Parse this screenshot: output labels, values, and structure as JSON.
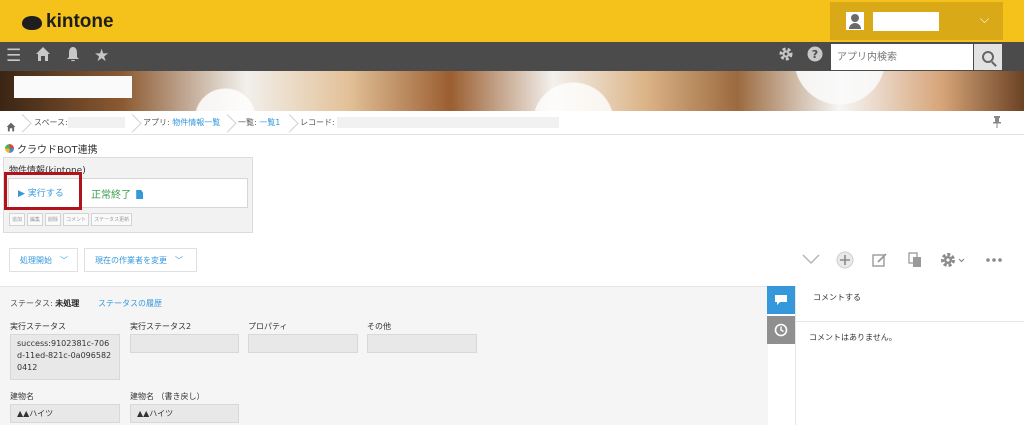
{
  "header": {
    "logo_text": "kintone",
    "user_chevron": "⌵"
  },
  "nav": {
    "search_placeholder": "アプリ内検索"
  },
  "breadcrumb": {
    "space_label": "スペース:",
    "app_prefix": "アプリ:",
    "app_name": "物件情報一覧",
    "list_prefix": "一覧:",
    "list_name": "一覧1",
    "record_label": "レコード:"
  },
  "plugin": {
    "title": "クラウドBOT連携",
    "box_label": "物件情報(kintone)",
    "run_button": "▶ 実行する",
    "result_text": "正常終了",
    "mini_tags": [
      "追加",
      "編集",
      "削除",
      "コメント",
      "ステータス更新"
    ]
  },
  "actions": {
    "process_start": "処理開始",
    "change_assignee": "現在の作業者を変更"
  },
  "record": {
    "status_label": "ステータス:",
    "status_value": "未処理",
    "status_history": "ステータスの履歴",
    "fields_row1": [
      {
        "label": "実行ステータス",
        "value": "success:9102381c-706d-11ed-821c-0a0965820412"
      },
      {
        "label": "実行ステータス2",
        "value": ""
      },
      {
        "label": "プロパティ",
        "value": ""
      },
      {
        "label": "その他",
        "value": ""
      }
    ],
    "fields_row2": [
      {
        "label": "建物名",
        "value": "▲▲ハイツ"
      },
      {
        "label": "建物名 （書き戻し）",
        "value": "▲▲ハイツ"
      }
    ]
  },
  "comments": {
    "placeholder": "コメントする",
    "empty_text": "コメントはありません。"
  },
  "colors": {
    "header_yellow": "#f5c21b",
    "nav_gray": "#4b4b4b",
    "link_blue": "#3498db",
    "success_green": "#3a9d4d",
    "highlight_red": "#b1131a"
  }
}
